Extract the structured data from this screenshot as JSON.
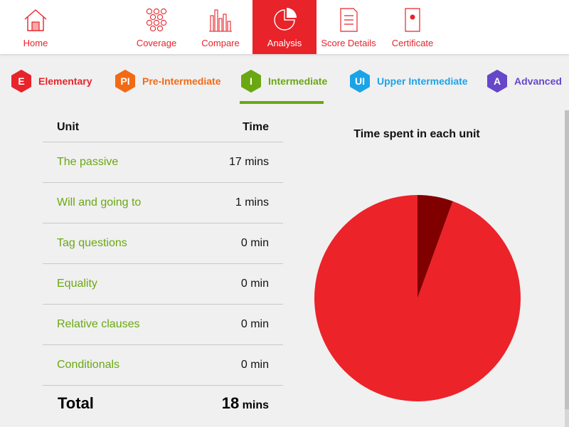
{
  "nav": {
    "items": [
      {
        "label": "Home",
        "icon": "home-icon"
      },
      {
        "label": "Coverage",
        "icon": "hexagon-grid-icon"
      },
      {
        "label": "Compare",
        "icon": "bar-chart-icon"
      },
      {
        "label": "Analysis",
        "icon": "pie-chart-icon",
        "active": true
      },
      {
        "label": "Score Details",
        "icon": "document-icon"
      },
      {
        "label": "Certificate",
        "icon": "certificate-icon"
      }
    ],
    "accent": "#e8232a"
  },
  "levels": [
    {
      "code": "E",
      "name": "Elementary",
      "color": "#e8232a"
    },
    {
      "code": "PI",
      "name": "Pre-Intermediate",
      "color": "#f26a14"
    },
    {
      "code": "I",
      "name": "Intermediate",
      "color": "#6aa812",
      "active": true
    },
    {
      "code": "UI",
      "name": "Upper Intermediate",
      "color": "#1ba3e8"
    },
    {
      "code": "A",
      "name": "Advanced",
      "color": "#6547c9"
    }
  ],
  "table": {
    "headers": {
      "unit": "Unit",
      "time": "Time"
    },
    "rows": [
      {
        "unit": "The passive",
        "time": "17 mins"
      },
      {
        "unit": "Will and going to",
        "time": "1 mins"
      },
      {
        "unit": "Tag questions",
        "time": "0 min"
      },
      {
        "unit": "Equality",
        "time": "0 min"
      },
      {
        "unit": "Relative clauses",
        "time": "0 min"
      },
      {
        "unit": "Conditionals",
        "time": "0 min"
      }
    ],
    "total": {
      "label": "Total",
      "value": "18",
      "unit": "mins"
    }
  },
  "chart_data": {
    "type": "pie",
    "title": "Time spent in each unit",
    "categories": [
      "The passive",
      "Will and going to",
      "Tag questions",
      "Equality",
      "Relative clauses",
      "Conditionals"
    ],
    "values": [
      17,
      1,
      0,
      0,
      0,
      0
    ],
    "colors": [
      "#ec2329",
      "#800000",
      "#e8232a",
      "#e8232a",
      "#e8232a",
      "#e8232a"
    ]
  }
}
